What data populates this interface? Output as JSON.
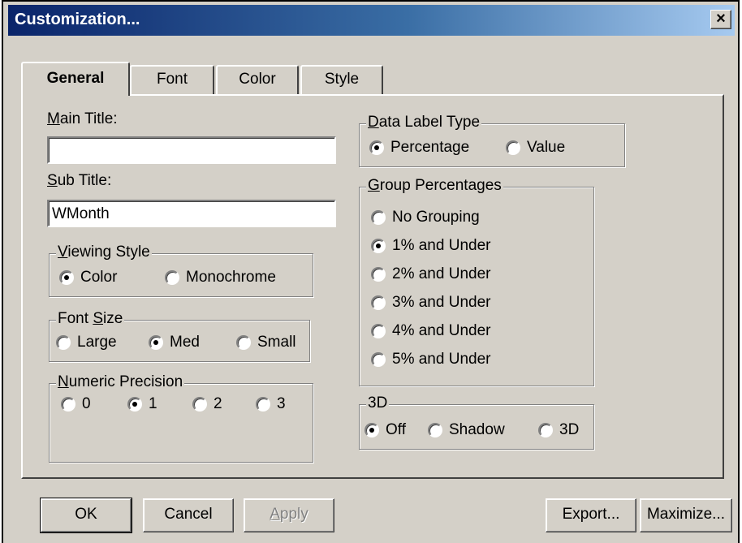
{
  "window": {
    "title": "Customization...",
    "close_glyph": "×"
  },
  "tabs": [
    {
      "label": "General",
      "active": true
    },
    {
      "label": "Font",
      "active": false
    },
    {
      "label": "Color",
      "active": false
    },
    {
      "label": "Style",
      "active": false
    }
  ],
  "main_title": {
    "label": "Main Title:",
    "accel": "M",
    "rest": "ain Title:",
    "value": ""
  },
  "sub_title": {
    "label": "Sub Title:",
    "accel": "S",
    "rest": "ub Title:",
    "value": "WMonth"
  },
  "viewing_style": {
    "title_accel": "V",
    "title_rest": "iewing Style",
    "options": [
      {
        "label": "Color",
        "checked": true
      },
      {
        "label": "Monochrome",
        "checked": false
      }
    ]
  },
  "font_size": {
    "title_pre": "Font ",
    "title_accel": "S",
    "title_rest": "ize",
    "options": [
      {
        "label": "Large",
        "checked": false
      },
      {
        "label": "Med",
        "checked": true
      },
      {
        "label": "Small",
        "checked": false
      }
    ]
  },
  "numeric_precision": {
    "title_accel": "N",
    "title_rest": "umeric Precision",
    "options": [
      {
        "label": "0",
        "checked": false
      },
      {
        "label": "1",
        "checked": true
      },
      {
        "label": "2",
        "checked": false
      },
      {
        "label": "3",
        "checked": false
      }
    ]
  },
  "data_label_type": {
    "title_accel": "D",
    "title_rest": "ata Label Type",
    "options": [
      {
        "label": "Percentage",
        "checked": true
      },
      {
        "label": "Value",
        "checked": false
      }
    ]
  },
  "group_percentages": {
    "title_accel": "G",
    "title_rest": "roup Percentages",
    "options": [
      {
        "label": "No Grouping",
        "checked": false
      },
      {
        "label": "1% and Under",
        "checked": true
      },
      {
        "label": "2% and Under",
        "checked": false
      },
      {
        "label": "3% and Under",
        "checked": false
      },
      {
        "label": "4% and Under",
        "checked": false
      },
      {
        "label": "5% and Under",
        "checked": false
      }
    ]
  },
  "three_d": {
    "title": "3D",
    "options": [
      {
        "label": "Off",
        "checked": true
      },
      {
        "label": "Shadow",
        "checked": false
      },
      {
        "label": "3D",
        "checked": false
      }
    ]
  },
  "buttons": {
    "ok": "OK",
    "cancel": "Cancel",
    "apply_accel": "A",
    "apply_rest": "pply",
    "export": "Export...",
    "maximize": "Maximize..."
  }
}
